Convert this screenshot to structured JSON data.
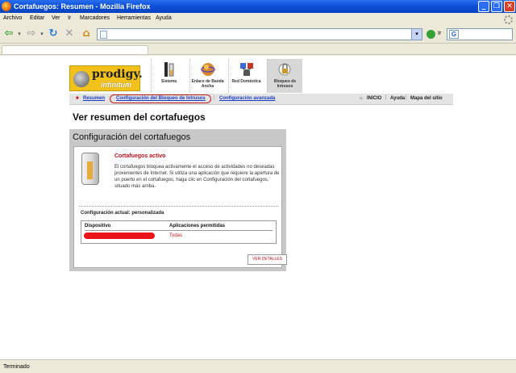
{
  "window": {
    "title": "Cortafuegos: Resumen - Mozilla Firefox",
    "minimize": "_",
    "maximize": "❐",
    "close": "✕"
  },
  "menu": [
    "Archivo",
    "Editar",
    "Ver",
    "Ir",
    "Marcadores",
    "Herramientas",
    "Ayuda"
  ],
  "toolbar": {
    "back": "⇦",
    "forward": "⇨",
    "dropdown": "▾",
    "reload": "↻",
    "stop": "✕",
    "home": "⌂",
    "url": "",
    "go_label": "Ir",
    "search_value": ""
  },
  "icons": {
    "back": "arrow-left",
    "forward": "arrow-right",
    "reload": "reload",
    "stop": "stop",
    "home": "home",
    "go": "green-go",
    "throbber": "spinner",
    "search": "google-g"
  },
  "tabs": [
    {
      "label": ""
    }
  ],
  "site": {
    "logo": {
      "brand": "prodigy.",
      "sub": "infinitum"
    },
    "nav_tabs": [
      {
        "label": "Sistema"
      },
      {
        "label": "Enlace de Banda Ancha"
      },
      {
        "label": "Red Doméstica"
      },
      {
        "label": "Bloqueo de Intrusos"
      }
    ],
    "subnav": {
      "links": [
        "Resumen",
        "Configuración del Bloqueo de Intrusos",
        "Configuración avanzada"
      ],
      "home": "INICIO",
      "help": "Ayuda",
      "sitemap": "Mapa del sitio"
    },
    "page_title": "Ver resumen del cortafuegos",
    "panel": {
      "title": "Configuración del cortafuegos",
      "status_title": "Cortafuegos activo",
      "status_desc": "El cortafuegos bloquea activamente el acceso de actividades no deseadas provenientes de Internet. Si utiliza una aplicación que requiere la apertura de un puerto en el cortafuegos, haga clic en Configuración del cortafuegos, situado más arriba.",
      "current_config": "Configuración actual: personalizada",
      "table": {
        "headers": [
          "Dispositivo",
          "Aplicaciones permitidas"
        ],
        "rows": [
          {
            "apps": "Todas"
          }
        ]
      },
      "details_button": "VER DETALLES"
    }
  },
  "status": "Terminado",
  "colors": {
    "accent_red": "#b8101a",
    "link_blue": "#1a3cc4",
    "logo_yellow": "#f2c21a",
    "titlebar_blue": "#0a4fd6"
  }
}
